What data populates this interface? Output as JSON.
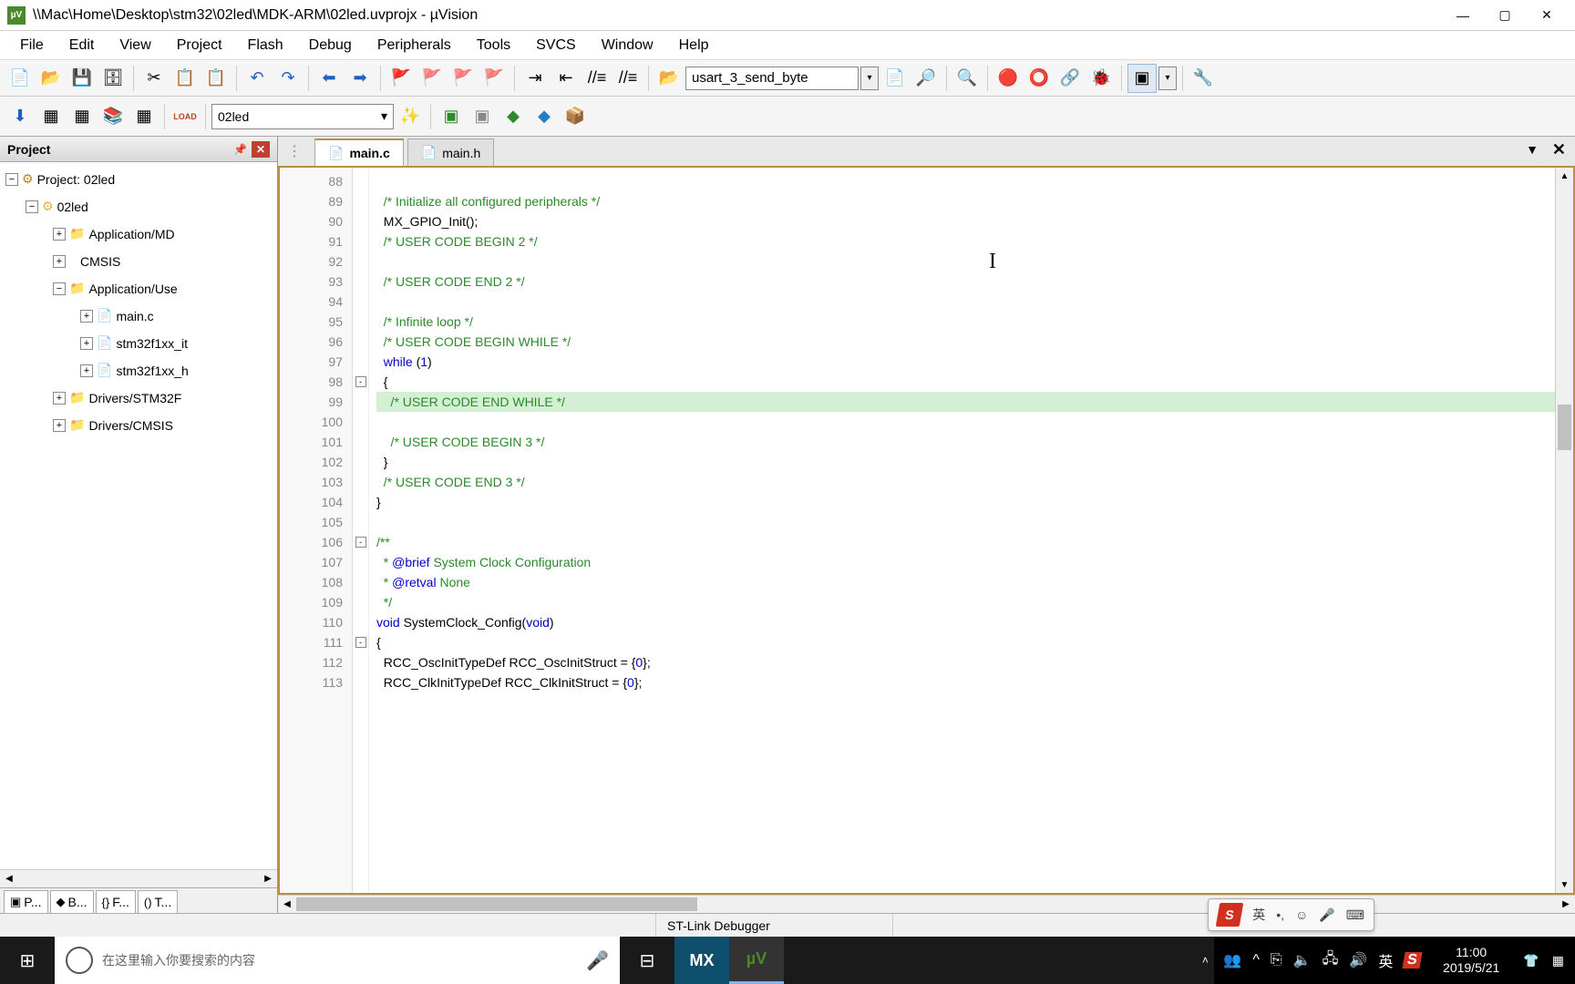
{
  "title_bar": {
    "path": "\\\\Mac\\Home\\Desktop\\stm32\\02led\\MDK-ARM\\02led.uvprojx - µVision"
  },
  "menu": [
    "File",
    "Edit",
    "View",
    "Project",
    "Flash",
    "Debug",
    "Peripherals",
    "Tools",
    "SVCS",
    "Window",
    "Help"
  ],
  "toolbar1": {
    "search_text": "usart_3_send_byte"
  },
  "toolbar2": {
    "target": "02led"
  },
  "project_panel": {
    "title": "Project",
    "root": "Project: 02led",
    "target": "02led",
    "groups": [
      {
        "name": "Application/MD",
        "expanded": false,
        "icon": "folder"
      },
      {
        "name": "CMSIS",
        "expanded": false,
        "icon": "diamond"
      },
      {
        "name": "Application/Use",
        "expanded": true,
        "icon": "folder",
        "files": [
          "main.c",
          "stm32f1xx_it",
          "stm32f1xx_h"
        ]
      },
      {
        "name": "Drivers/STM32F",
        "expanded": false,
        "icon": "folder"
      },
      {
        "name": "Drivers/CMSIS",
        "expanded": false,
        "icon": "folder"
      }
    ],
    "tabs": [
      "P...",
      "B...",
      "F...",
      "T..."
    ]
  },
  "editor": {
    "tabs": [
      {
        "name": "main.c",
        "active": true
      },
      {
        "name": "main.h",
        "active": false
      }
    ],
    "first_line": 88,
    "lines": [
      {
        "n": 88,
        "text": ""
      },
      {
        "n": 89,
        "text": "  /* Initialize all configured peripherals */",
        "cls": "c-comment"
      },
      {
        "n": 90,
        "text": "  MX_GPIO_Init();",
        "cls": "c-plain"
      },
      {
        "n": 91,
        "text": "  /* USER CODE BEGIN 2 */",
        "cls": "c-comment"
      },
      {
        "n": 92,
        "text": ""
      },
      {
        "n": 93,
        "text": "  /* USER CODE END 2 */",
        "cls": "c-comment"
      },
      {
        "n": 94,
        "text": ""
      },
      {
        "n": 95,
        "text": "  /* Infinite loop */",
        "cls": "c-comment"
      },
      {
        "n": 96,
        "text": "  /* USER CODE BEGIN WHILE */",
        "cls": "c-comment"
      },
      {
        "n": 97,
        "html": "  <span class='c-keyword'>while</span> (<span class='c-number'>1</span>)"
      },
      {
        "n": 98,
        "text": "  {",
        "cls": "c-plain",
        "fold": "-"
      },
      {
        "n": 99,
        "text": "    /* USER CODE END WHILE */",
        "cls": "c-comment",
        "hl": true
      },
      {
        "n": 100,
        "text": ""
      },
      {
        "n": 101,
        "text": "    /* USER CODE BEGIN 3 */",
        "cls": "c-comment"
      },
      {
        "n": 102,
        "text": "  }",
        "cls": "c-plain"
      },
      {
        "n": 103,
        "text": "  /* USER CODE END 3 */",
        "cls": "c-comment"
      },
      {
        "n": 104,
        "text": "}",
        "cls": "c-plain"
      },
      {
        "n": 105,
        "text": ""
      },
      {
        "n": 106,
        "html": "<span class='c-comment'>/**</span>",
        "fold": "-"
      },
      {
        "n": 107,
        "html": "<span class='c-comment'>  * </span><span class='c-doc-tag'>@brief</span><span class='c-comment'> System Clock Configuration</span>"
      },
      {
        "n": 108,
        "html": "<span class='c-comment'>  * </span><span class='c-doc-tag'>@retval</span><span class='c-comment'> None</span>"
      },
      {
        "n": 109,
        "text": "  */",
        "cls": "c-comment"
      },
      {
        "n": 110,
        "html": "<span class='c-keyword'>void</span> SystemClock_Config(<span class='c-keyword'>void</span>)"
      },
      {
        "n": 111,
        "text": "{",
        "cls": "c-plain",
        "fold": "-"
      },
      {
        "n": 112,
        "html": "  RCC_OscInitTypeDef RCC_OscInitStruct = {<span class='c-number'>0</span>};"
      },
      {
        "n": 113,
        "html": "  RCC_ClkInitTypeDef RCC_ClkInitStruct = {<span class='c-number'>0</span>};"
      }
    ]
  },
  "status_bar": {
    "debugger": "ST-Link Debugger"
  },
  "ime_bar": {
    "logo": "S",
    "items": [
      "英",
      "•,",
      "☺",
      "🎤",
      "⌨"
    ]
  },
  "taskbar": {
    "search_placeholder": "在这里输入你要搜索的内容",
    "tray": [
      "ᯤ",
      "英",
      "S"
    ],
    "tray_left": [
      "👥",
      "^",
      "⎘",
      "🔈",
      "🖧",
      "🔊"
    ],
    "time": "11:00",
    "date": "2019/5/21",
    "side": [
      "👕",
      "▦"
    ]
  }
}
